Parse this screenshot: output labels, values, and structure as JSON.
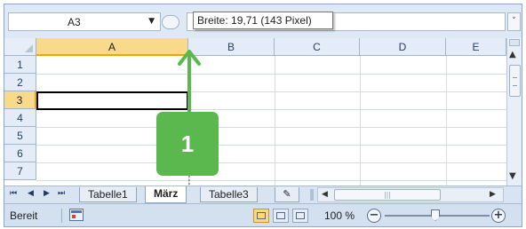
{
  "formula_bar": {
    "name_box": "A3",
    "tooltip": "Breite: 19,71 (143 Pixel)"
  },
  "columns": [
    "A",
    "B",
    "C",
    "D",
    "E"
  ],
  "rows": [
    "1",
    "2",
    "3",
    "4",
    "5",
    "6",
    "7"
  ],
  "selected_cell": "A3",
  "sheet_tabs": [
    "Tabelle1",
    "März",
    "Tabelle3"
  ],
  "active_tab": "März",
  "status": {
    "ready_text": "Bereit",
    "zoom": "100 %"
  },
  "annotation": {
    "badge": "1",
    "color": "#5ab84f"
  },
  "colors": {
    "selection_header": "#f9d98a",
    "header_bg": "#e4ecf7",
    "frame": "#dfe9f5"
  }
}
